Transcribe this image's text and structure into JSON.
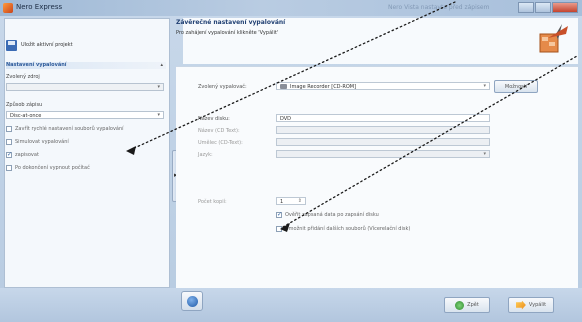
{
  "window": {
    "title": "Nero Express",
    "blurred_caption": "Nero Vista nastavte před zápisem"
  },
  "left": {
    "new_project": "Uložit aktivní projekt",
    "section": "Nastavení vypalování",
    "source_label": "Zvolený zdroj",
    "source_value": "",
    "speed_label": "Způsob zápisu",
    "speed_value": "Disc-at-once",
    "options": [
      {
        "label": "Zavřít rychlé nastavení souborů vypalování",
        "checked": false
      },
      {
        "label": "Simulovat vypalování",
        "checked": false
      },
      {
        "label": "zapisovat",
        "checked": true
      },
      {
        "label": "Po dokončení vypnout počítač",
        "checked": false
      }
    ]
  },
  "right": {
    "title": "Závěrečné nastavení vypalování",
    "subtitle": "Pro zahájení vypalování klikněte 'Vypálit'",
    "recorder_label": "Zvolený vypalovač:",
    "recorder_value": "Image Recorder [CD-ROM]",
    "options_button": "Možnosti",
    "disc_name_label": "Název disku:",
    "disc_name_value": "DVD",
    "title_label": "Název (CD Text):",
    "artist_label": "Umělec (CD-Text):",
    "language_label": "Jazyk:",
    "copies_label": "Počet kopií:",
    "copies_value": "1",
    "verify_label": "Ověřit zapsaná data po zapsání disku",
    "multisession_label": "Umožnit přidání dalších souborů (Vícerelační disk)"
  },
  "footer": {
    "back_label": "Zpět",
    "burn_label": "Vypálit"
  },
  "colors": {
    "accent": "#2d5a9a",
    "panel": "#b7cbe1"
  }
}
